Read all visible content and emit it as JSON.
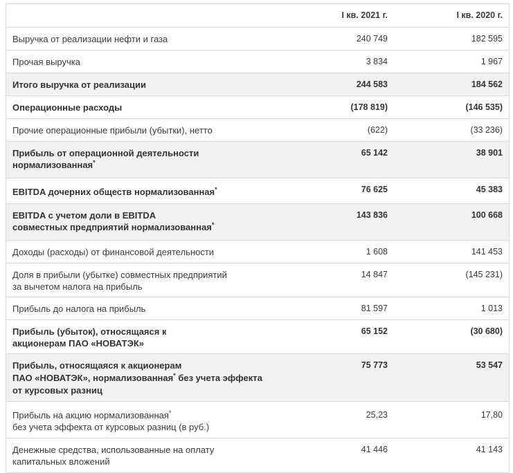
{
  "header": {
    "col1": "I кв. 2021 г.",
    "col2": "I кв. 2020 г."
  },
  "rows": [
    {
      "l1": "Выручка от реализации нефти и газа",
      "v1": "240 749",
      "v2": "182 595"
    },
    {
      "l1": "Прочая выручка",
      "v1": "3 834",
      "v2": "1 967"
    },
    {
      "l1": "Итого выручка от реализации",
      "v1": "244 583",
      "v2": "184 562"
    },
    {
      "l1": "Операционные расходы",
      "v1": "(178 819)",
      "v2": "(146 535)"
    },
    {
      "l1": "Прочие операционные прибыли (убытки), нетто",
      "v1": "(622)",
      "v2": "(33 236)"
    },
    {
      "l1": "Прибыль от операционной деятельности",
      "l2": "нормализованная",
      "mark": "*",
      "v1": "65 142",
      "v2": "38 901"
    },
    {
      "l1": "EBITDA дочерних обществ нормализованная",
      "mark": "*",
      "v1": "76 625",
      "v2": "45 383"
    },
    {
      "l1": "EBITDA с учетом доли в EBITDA",
      "l2": "совместных предприятий нормализованная",
      "mark": "*",
      "v1": "143 836",
      "v2": "100 668"
    },
    {
      "l1": "Доходы (расходы) от финансовой деятельности",
      "v1": "1 608",
      "v2": "141 453"
    },
    {
      "l1": "Доля в прибыли (убытке) совместных предприятий",
      "l2": "за вычетом налога на прибыль",
      "v1": "14 847",
      "v2": "(145 231)"
    },
    {
      "l1": "Прибыль до налога на прибыль",
      "v1": "81 597",
      "v2": "1 013"
    },
    {
      "l1": "Прибыль (убыток), относящаяся к",
      "l2": "акционерам ПАО «НОВАТЭК»",
      "v1": "65 152",
      "v2": "(30 680)"
    },
    {
      "l1": "Прибыль, относящаяся к акционерам",
      "l2a": "ПАО «НОВАТЭК», нормализованная",
      "mark": "*",
      "l2b": " без учета эффекта",
      "l3": "от курсовых разниц",
      "v1": "75 773",
      "v2": "53 547"
    },
    {
      "l1a": "Прибыль на акцию нормализованная",
      "mark": "*",
      "l2": "без учета эффекта от курсовых разниц (в руб.)",
      "v1": "25,23",
      "v2": "17,80"
    },
    {
      "l1": "Денежные средства, использованные на оплату",
      "l2": "капитальных вложений",
      "v1": "41 446",
      "v2": "41 143"
    }
  ]
}
